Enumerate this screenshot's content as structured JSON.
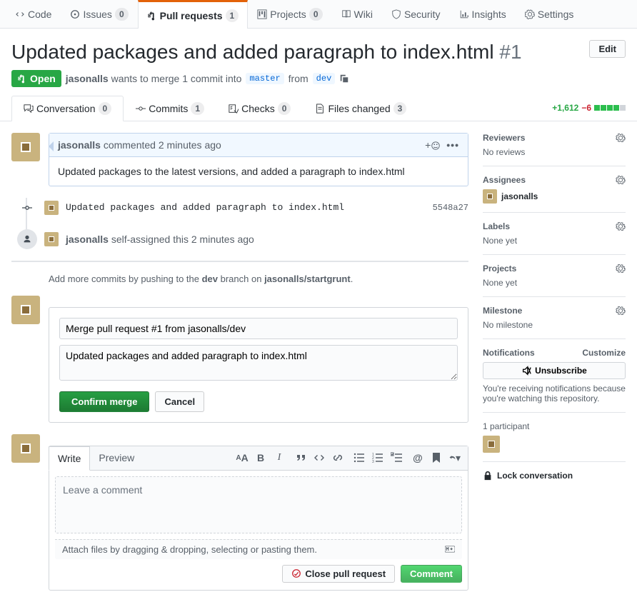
{
  "repoNav": {
    "code": "Code",
    "issues": "Issues",
    "issuesCount": "0",
    "pulls": "Pull requests",
    "pullsCount": "1",
    "projects": "Projects",
    "projectsCount": "0",
    "wiki": "Wiki",
    "security": "Security",
    "insights": "Insights",
    "settings": "Settings"
  },
  "pr": {
    "title": "Updated packages and added paragraph to index.html",
    "number": "#1",
    "state": "Open",
    "editLabel": "Edit",
    "author": "jasonalls",
    "metaText1": "wants to merge 1 commit into",
    "baseBranch": "master",
    "metaFrom": "from",
    "headBranch": "dev"
  },
  "tabs": {
    "conversation": "Conversation",
    "conversationCount": "0",
    "commits": "Commits",
    "commitsCount": "1",
    "checks": "Checks",
    "checksCount": "0",
    "files": "Files changed",
    "filesCount": "3",
    "diffAdd": "+1,612",
    "diffDel": "−6"
  },
  "firstComment": {
    "author": "jasonalls",
    "action": "commented",
    "timeAgo": "2 minutes ago",
    "body": "Updated packages to the latest versions, and added a paragraph to index.html"
  },
  "commitEvent": {
    "message": "Updated packages and added paragraph to index.html",
    "sha": "5548a27"
  },
  "assignEvent": {
    "author": "jasonalls",
    "text": "self-assigned this 2 minutes ago"
  },
  "pushHint": {
    "prefix": "Add more commits by pushing to the ",
    "branch": "dev",
    "mid": " branch on ",
    "repo": "jasonalls/startgrunt",
    "suffix": "."
  },
  "merge": {
    "titleValue": "Merge pull request #1 from jasonalls/dev",
    "bodyValue": "Updated packages and added paragraph to index.html",
    "confirm": "Confirm merge",
    "cancel": "Cancel"
  },
  "newComment": {
    "writeTab": "Write",
    "previewTab": "Preview",
    "placeholder": "Leave a comment",
    "attachHint": "Attach files by dragging & dropping, selecting or pasting them.",
    "closeBtn": "Close pull request",
    "commentBtn": "Comment"
  },
  "sidebar": {
    "reviewers": "Reviewers",
    "noReviews": "No reviews",
    "assignees": "Assignees",
    "assignee": "jasonalls",
    "labels": "Labels",
    "noneYet": "None yet",
    "projects": "Projects",
    "milestone": "Milestone",
    "noMilestone": "No milestone",
    "notifications": "Notifications",
    "customize": "Customize",
    "unsubscribe": "Unsubscribe",
    "notifDesc": "You're receiving notifications because you're watching this repository.",
    "participants": "1 participant",
    "lock": "Lock conversation"
  }
}
